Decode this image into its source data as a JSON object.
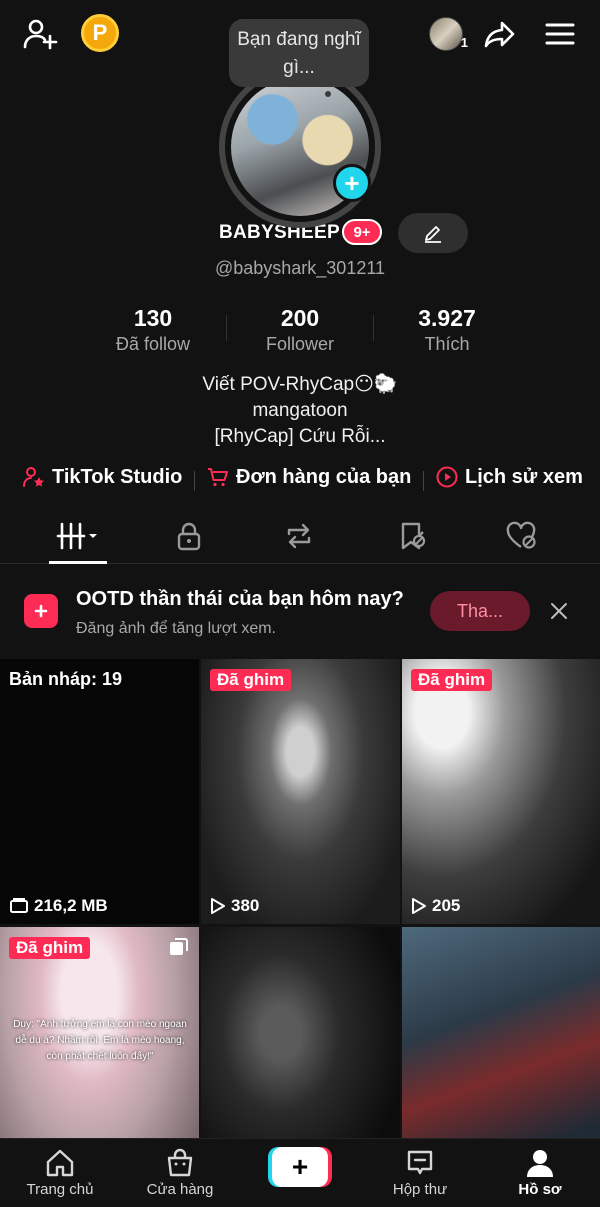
{
  "header": {
    "coin_label": "P",
    "mini_avatar_count": "1",
    "thought_bubble": "Bạn đang nghĩ gì..."
  },
  "profile": {
    "username": "BABYSHEEP",
    "badge": "9+",
    "handle": "@babyshark_301211",
    "avatar_plus": "+"
  },
  "stats": [
    {
      "value": "130",
      "label": "Đã follow"
    },
    {
      "value": "200",
      "label": "Follower"
    },
    {
      "value": "3.927",
      "label": "Thích"
    }
  ],
  "bio": {
    "line1": "Viết POV-RhyCap😶🐑",
    "line2": "mangatoon",
    "line3": "[RhyCap] Cứu Rỗi..."
  },
  "links": {
    "studio": "TikTok Studio",
    "orders": "Đơn hàng của bạn",
    "history": "Lịch sử xem"
  },
  "promo": {
    "title": "OOTD thần thái của bạn hôm nay?",
    "subtitle": "Đăng ảnh để tăng lượt xem.",
    "button": "Tha..."
  },
  "grid": {
    "draft_label": "Bản nháp: 19",
    "draft_size": "216,2 MB",
    "pinned_label": "Đã ghim",
    "views_2": "380",
    "views_3": "205",
    "caption_4": "Duy: \"Anh tưởng em là con mèo ngoan dễ dụ à? Nhầm rồi. Em là mèo hoang, còn phát chết luôn đấy!\""
  },
  "nav": {
    "home": "Trang chủ",
    "shop": "Cửa hàng",
    "create": "+",
    "inbox": "Hộp thư",
    "profile": "Hồ sơ"
  },
  "colors": {
    "background": "#121212",
    "accent_red": "#fe2c55",
    "accent_cyan": "#20d5ec",
    "coin": "#f5a80c"
  }
}
